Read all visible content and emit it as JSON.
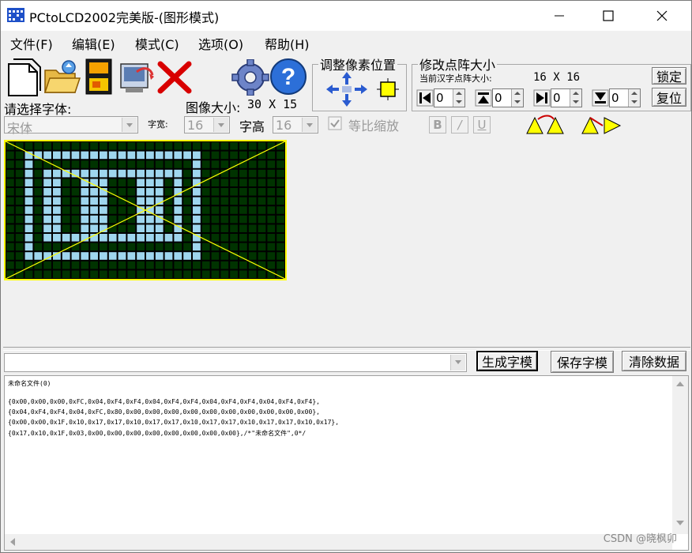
{
  "window": {
    "title": "PCtoLCD2002完美版-(图形模式)",
    "controls": [
      "minimize",
      "maximize",
      "close"
    ]
  },
  "menu": [
    "文件(F)",
    "编辑(E)",
    "模式(C)",
    "选项(O)",
    "帮助(H)"
  ],
  "toolbar": {
    "icons": [
      "new-icon",
      "open-icon",
      "save-icon",
      "export-icon",
      "delete-icon",
      "settings-icon",
      "help-icon"
    ]
  },
  "font": {
    "select_label": "请选择字体:",
    "font_value": "宋体",
    "width_label": "字宽:",
    "width_value": "16",
    "height_label": "字高",
    "height_value": "16",
    "image_size_label": "图像大小:",
    "image_size_value": "30 X 15",
    "proportional_label": "等比缩放",
    "bold": "B",
    "italic": "/",
    "underline": "U"
  },
  "pixel_adjust": {
    "title": "调整像素位置"
  },
  "matrix": {
    "title": "修改点阵大小",
    "current_label": "当前汉字点阵大小:",
    "current_value": "16 X 16",
    "lock_button": "锁定",
    "reset_button": "复位",
    "spin_values": [
      "0",
      "0",
      "0",
      "0"
    ]
  },
  "pixel_image": {
    "cols": 30,
    "rows": 15,
    "on_color": "#9fd6ee",
    "off_color": "#003300",
    "border_color": "#ffff00",
    "cross_color": "#ffff00"
  },
  "actions": {
    "input_value": "",
    "generate": "生成字模",
    "save": "保存字模",
    "clear": "清除数据"
  },
  "output": {
    "lines": [
      "未命名文件(0)",
      "",
      "{0x00,0x00,0x00,0xFC,0x04,0xF4,0xF4,0x04,0xF4,0xF4,0x04,0xF4,0xF4,0x04,0xF4,0xF4},",
      "{0x04,0xF4,0xF4,0x04,0xFC,0x80,0x00,0x00,0x00,0x00,0x00,0x00,0x00,0x00,0x00,0x00},",
      "{0x00,0x00,0x1F,0x10,0x17,0x17,0x10,0x17,0x17,0x10,0x17,0x17,0x10,0x17,0x17,0x10,0x17},",
      "{0x17,0x10,0x1F,0x03,0x00,0x00,0x00,0x00,0x00,0x00,0x00,0x00},/*\"未命名文件\",0*/"
    ]
  },
  "watermark": "CSDN @晓枫卯"
}
